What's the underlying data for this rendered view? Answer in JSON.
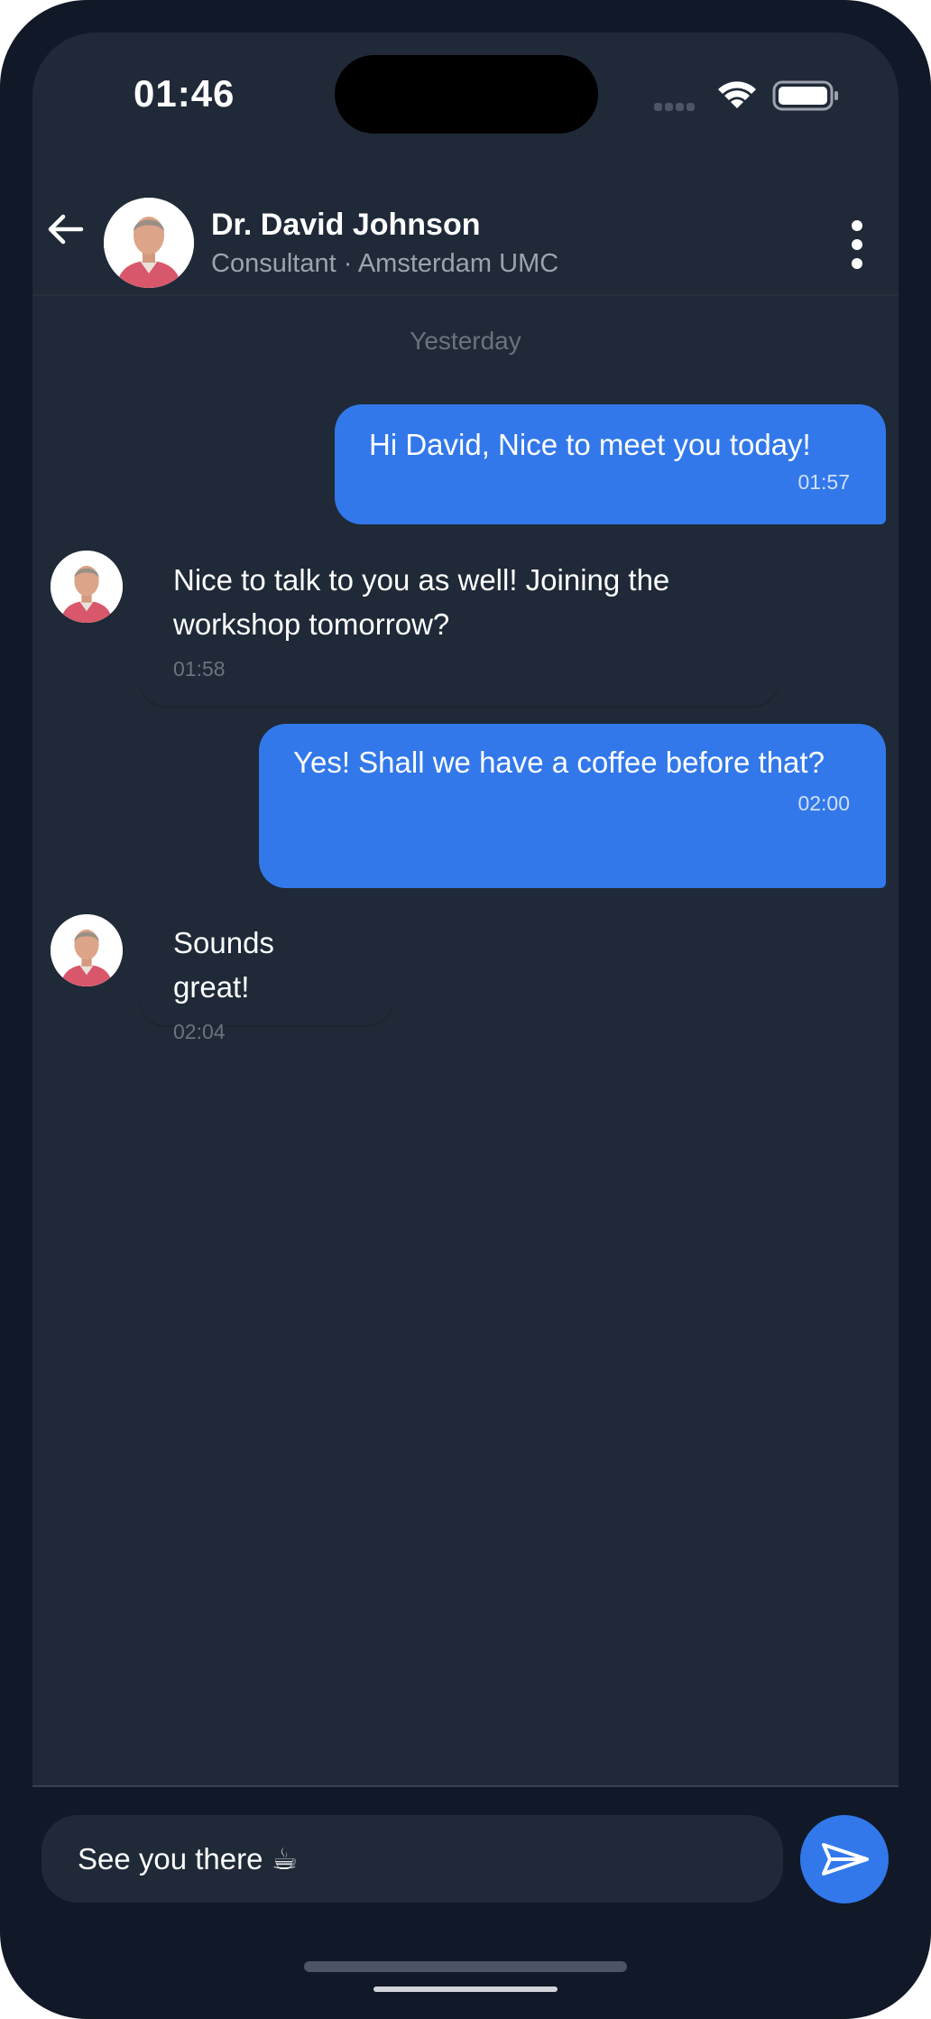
{
  "status_bar": {
    "time": "01:46",
    "icons": [
      "cellular-signal-icon",
      "wifi-icon",
      "battery-icon"
    ]
  },
  "header": {
    "back_icon": "arrow-left-icon",
    "contact_name": "Dr. David Johnson",
    "contact_subtitle": "Consultant · Amsterdam UMC",
    "more_icon": "vertical-dots-icon"
  },
  "conversation": {
    "day_separator": "Yesterday",
    "messages": [
      {
        "direction": "outgoing",
        "text": "Hi David, Nice to meet you today!",
        "time": "01:57"
      },
      {
        "direction": "incoming",
        "text": "Nice to talk to you as well! Joining the workshop tomorrow?",
        "time": "01:58"
      },
      {
        "direction": "outgoing",
        "text": "Yes! Shall we have a coffee before that?",
        "time": "02:00"
      },
      {
        "direction": "incoming",
        "text": "Sounds great!",
        "time": "02:04"
      }
    ]
  },
  "composer": {
    "value": "See you there ☕",
    "send_icon": "paper-plane-icon"
  },
  "colors": {
    "frame": "#111827",
    "screen": "#1f2937",
    "accent": "#3278ea",
    "muted_text": "#9ca3af"
  }
}
